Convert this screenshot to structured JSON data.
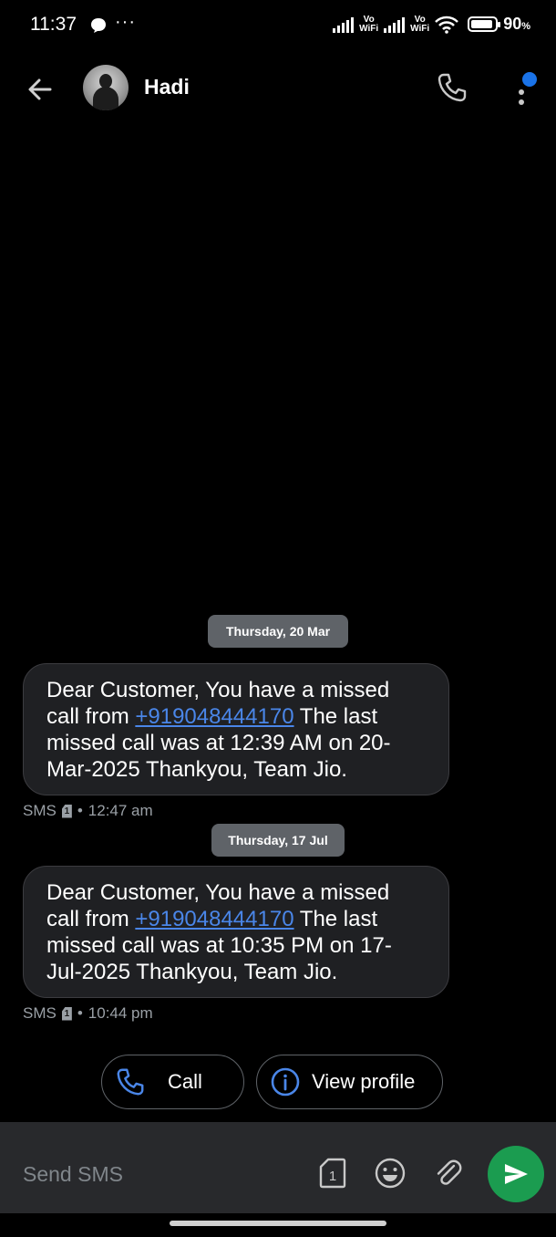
{
  "status_bar": {
    "time": "11:37",
    "overflow_dots": "···",
    "vowifi_1": "Vo\nWiFi",
    "vowifi_2": "Vo\nWiFi",
    "battery_percent": "90",
    "battery_unit": "%",
    "battery_level": 0.9
  },
  "header": {
    "contact_name": "Hadi",
    "accent_color": "#1a73e8"
  },
  "messages": [
    {
      "date_label": "Thursday, 20 Mar",
      "text_before": "Dear Customer, You have a missed call from ",
      "phone_link": "+919048444170",
      "text_after": " The last missed call was at 12:39 AM on 20-Mar-2025 Thankyou, Team Jio.",
      "channel": "SMS",
      "sim_slot": "1",
      "separator": "•",
      "time": "12:47 am"
    },
    {
      "date_label": "Thursday, 17 Jul",
      "text_before": "Dear Customer, You have a missed call from ",
      "phone_link": "+919048444170",
      "text_after": " The last missed call was at 10:35 PM on 17-Jul-2025 Thankyou, Team Jio.",
      "channel": "SMS",
      "sim_slot": "1",
      "separator": "•",
      "time": "10:44 pm"
    }
  ],
  "actions": {
    "call_label": "Call",
    "view_profile_label": "View profile"
  },
  "compose": {
    "placeholder": "Send SMS",
    "sim_slot": "1",
    "send_color": "#1b9c50"
  },
  "icons": {
    "back": "arrow-left-icon",
    "phone": "phone-icon",
    "more": "more-vert-icon",
    "info": "info-icon",
    "sim": "sim-card-icon",
    "emoji": "emoji-icon",
    "attach": "paperclip-icon",
    "send": "send-icon"
  }
}
